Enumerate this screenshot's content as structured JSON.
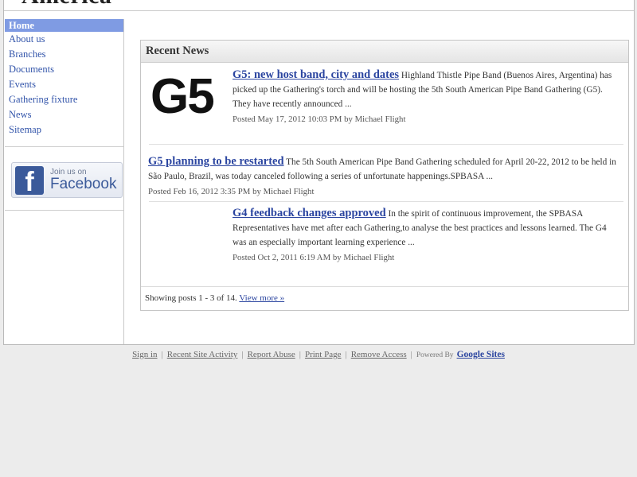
{
  "site": {
    "title": "America"
  },
  "sidebar": {
    "items": [
      {
        "label": "Home",
        "active": true
      },
      {
        "label": "About us"
      },
      {
        "label": "Branches"
      },
      {
        "label": "Documents"
      },
      {
        "label": "Events"
      },
      {
        "label": "Gathering fixture"
      },
      {
        "label": "News"
      },
      {
        "label": "Sitemap"
      }
    ],
    "facebook": {
      "small": "Join us on",
      "big": "Facebook",
      "logo": "f"
    }
  },
  "news": {
    "header": "Recent News",
    "image_text": "G5",
    "posts": [
      {
        "title": "G5: new host band, city and dates",
        "body": "Highland Thistle Pipe Band (Buenos Aires, Argentina) has picked up the Gathering's torch and will be hosting the 5th South American Pipe Band Gathering (G5). They have recently announced ...",
        "meta": "Posted May 17, 2012 10:03 PM by Michael Flight"
      },
      {
        "title": "G5 planning to be restarted",
        "body": "The 5th South American Pipe Band Gathering scheduled for April 20-22, 2012 to be held in São Paulo, Brazil, was today canceled following a series of unfortunate happenings.SPBASA ...",
        "meta": "Posted Feb 16, 2012 3:35 PM by Michael Flight"
      },
      {
        "title": "G4 feedback changes approved",
        "body": "In the spirit of continuous improvement, the SPBASA Representatives have met after each Gathering,to analyse the best practices and lessons learned. The G4 was an especially important learning experience ...",
        "meta": "Posted Oct 2, 2011 6:19 AM by Michael Flight"
      }
    ],
    "footer_text": "Showing posts 1 - 3 of 14.",
    "view_more": "View more »"
  },
  "footer": {
    "links": [
      "Sign in",
      "Recent Site Activity",
      "Report Abuse",
      "Print Page",
      "Remove Access"
    ],
    "powered_by": "Powered By",
    "google_sites": "Google Sites"
  }
}
